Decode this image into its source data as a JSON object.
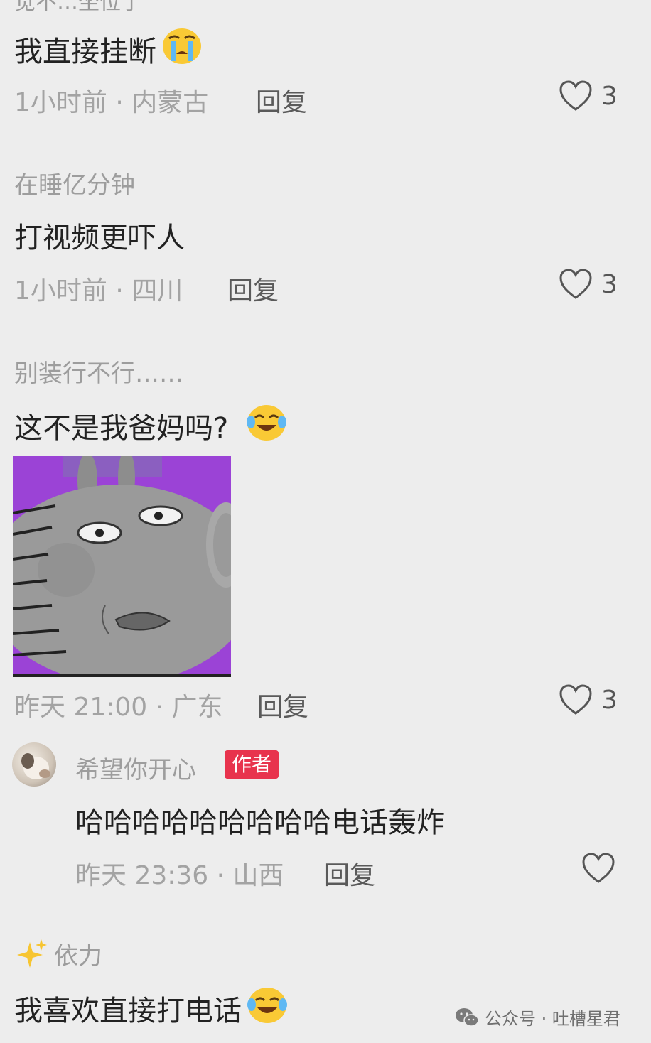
{
  "top_partial_text": "觉不…坐位了",
  "comments": [
    {
      "text": "我直接挂断",
      "emoji": "loudly-crying-face",
      "time_location": "1小时前 · 内蒙古",
      "reply_label": "回复",
      "likes": "3"
    },
    {
      "username": "在睡亿分钟",
      "text": "打视频更吓人",
      "time_location": "1小时前 · 四川",
      "reply_label": "回复",
      "likes": "3"
    },
    {
      "username": "别装行不行……",
      "text": "这不是我爸妈吗?",
      "emoji": "tears-of-joy-face",
      "image": "meme-gray-cartoon-pig-face",
      "time_location": "昨天 21:00 · 广东",
      "reply_label": "回复",
      "likes": "3"
    },
    {
      "username": "希望你开心",
      "author_badge": "作者",
      "text": "哈哈哈哈哈哈哈哈哈电话轰炸",
      "time_location": "昨天 23:36 · 山西",
      "reply_label": "回复",
      "likes": ""
    },
    {
      "username": "依力",
      "username_prefix": "sparkles-icon",
      "text": "我喜欢直接打电话",
      "emoji": "tears-of-joy-face"
    }
  ],
  "watermark": {
    "icon": "wechat-icon",
    "text": "公众号 · 吐槽星君"
  },
  "colors": {
    "background": "#ededed",
    "author_badge": "#e8334d",
    "meme_background": "#9b43d6"
  }
}
